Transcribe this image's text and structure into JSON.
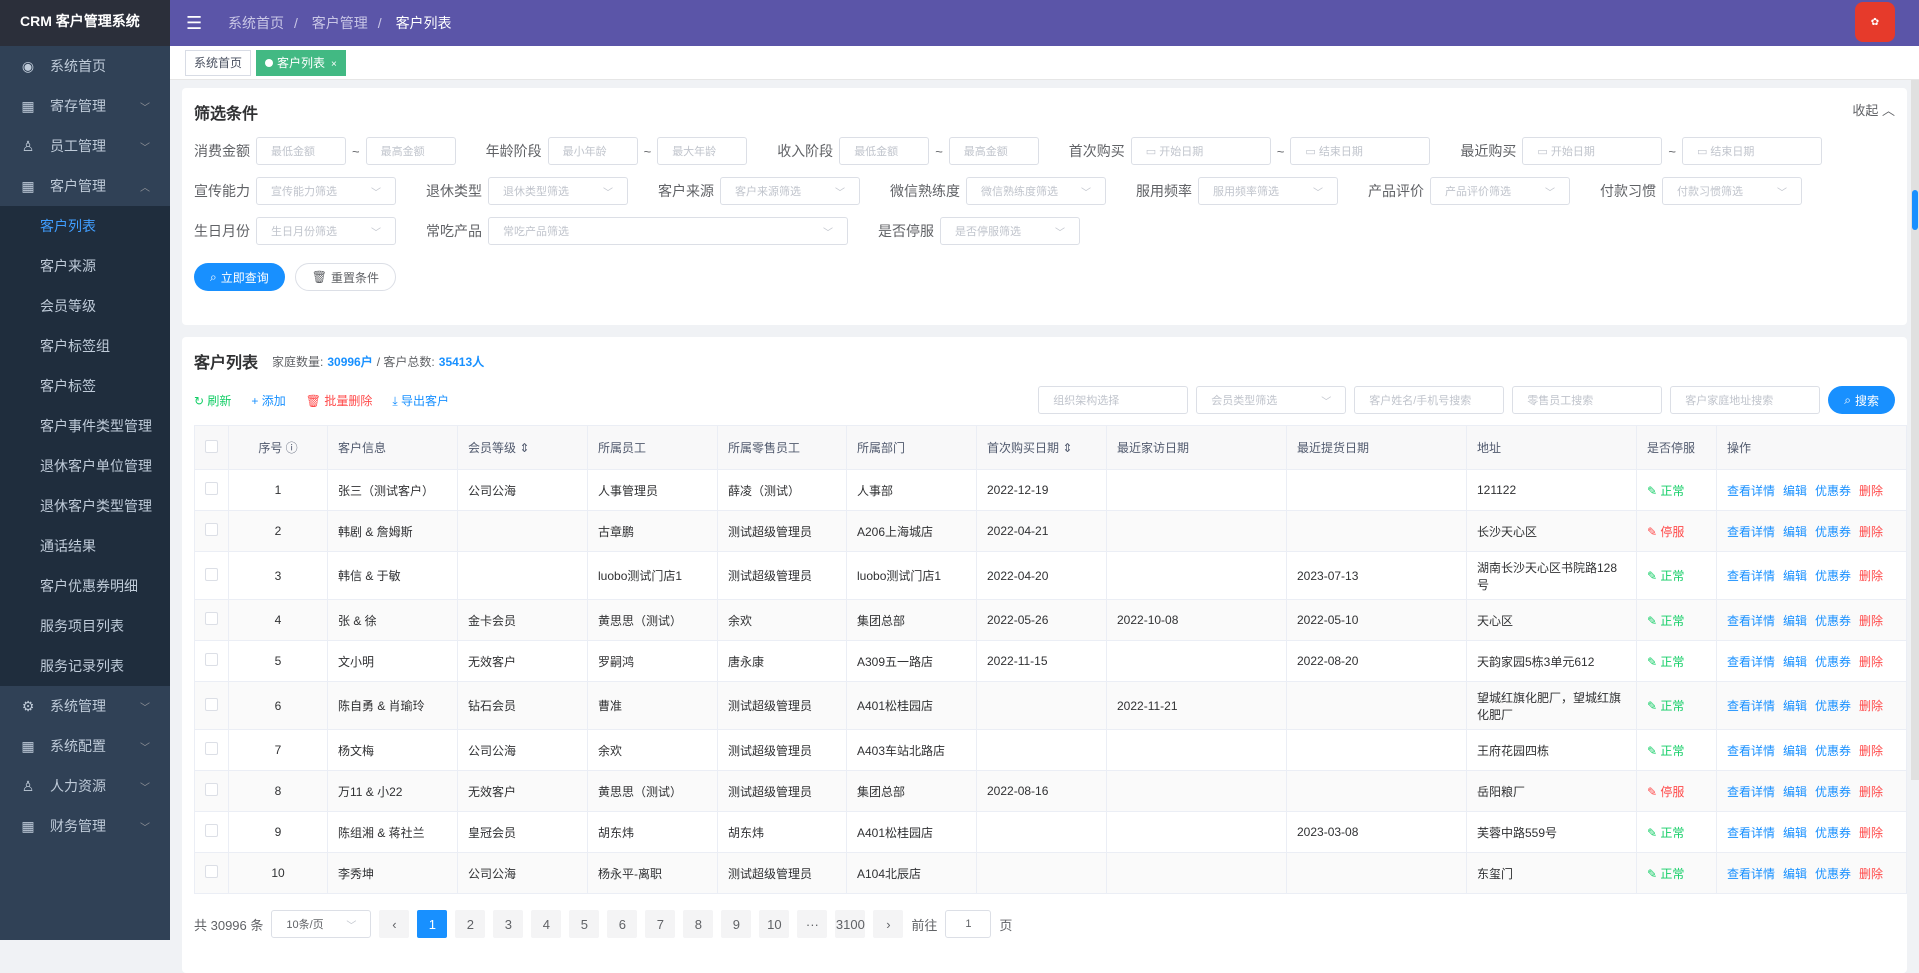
{
  "app": {
    "title": "CRM 客户管理系统"
  },
  "menu": [
    {
      "icon": "dashboard-icon",
      "glyph": "◉",
      "label": "系统首页",
      "arrow": ""
    },
    {
      "icon": "grid-icon",
      "glyph": "▦",
      "label": "寄存管理",
      "arrow": "﹀"
    },
    {
      "icon": "user-icon",
      "glyph": "♙",
      "label": "员工管理",
      "arrow": "﹀"
    },
    {
      "icon": "grid-icon",
      "glyph": "▦",
      "label": "客户管理",
      "arrow": "︿"
    }
  ],
  "submenu": [
    "客户列表",
    "客户来源",
    "会员等级",
    "客户标签组",
    "客户标签",
    "客户事件类型管理",
    "退休客户单位管理",
    "退休客户类型管理",
    "通话结果",
    "客户优惠券明细",
    "服务项目列表",
    "服务记录列表"
  ],
  "menu2": [
    {
      "icon": "gear-icon",
      "glyph": "⚙",
      "label": "系统管理",
      "arrow": "﹀"
    },
    {
      "icon": "grid-icon",
      "glyph": "▦",
      "label": "系统配置",
      "arrow": "﹀"
    },
    {
      "icon": "user-icon",
      "glyph": "♙",
      "label": "人力资源",
      "arrow": "﹀"
    },
    {
      "icon": "grid-icon",
      "glyph": "▦",
      "label": "财务管理",
      "arrow": "﹀"
    }
  ],
  "breadcrumb": [
    "系统首页",
    "客户管理",
    "客户列表"
  ],
  "tags": {
    "home": "系统首页",
    "current": "客户列表"
  },
  "filter": {
    "title": "筛选条件",
    "collapse": "收起 ︿",
    "consume": {
      "label": "消费金额",
      "min": "最低金额",
      "max": "最高金额"
    },
    "age": {
      "label": "年龄阶段",
      "min": "最小年龄",
      "max": "最大年龄"
    },
    "income": {
      "label": "收入阶段",
      "min": "最低金额",
      "max": "最高金额"
    },
    "first": {
      "label": "首次购买",
      "start": "开始日期",
      "end": "结束日期"
    },
    "recent": {
      "label": "最近购买",
      "start": "开始日期",
      "end": "结束日期"
    },
    "ability": {
      "label": "宣传能力",
      "ph": "宣传能力筛选"
    },
    "retire": {
      "label": "退休类型",
      "ph": "退休类型筛选"
    },
    "source": {
      "label": "客户来源",
      "ph": "客户来源筛选"
    },
    "wechat": {
      "label": "微信熟练度",
      "ph": "微信熟练度筛选"
    },
    "freq": {
      "label": "服用频率",
      "ph": "服用频率筛选"
    },
    "rating": {
      "label": "产品评价",
      "ph": "产品评价筛选"
    },
    "pay": {
      "label": "付款习惯",
      "ph": "付款习惯筛选"
    },
    "birth": {
      "label": "生日月份",
      "ph": "生日月份筛选"
    },
    "product": {
      "label": "常吃产品",
      "ph": "常吃产品筛选"
    },
    "stop": {
      "label": "是否停服",
      "ph": "是否停服筛选"
    },
    "query_btn": "立即查询",
    "reset_btn": "重置条件"
  },
  "list": {
    "title": "客户列表",
    "family_label": "家庭数量:",
    "family_count": "30996户",
    "sep": "/",
    "total_label": "客户总数:",
    "total_count": "35413人",
    "refresh": "刷新",
    "add": "添加",
    "batch_delete": "批量删除",
    "export": "导出客户",
    "search": {
      "org": "组织架构选择",
      "member": "会员类型筛选",
      "name": "客户姓名/手机号搜索",
      "staff": "零售员工搜索",
      "addr": "客户家庭地址搜索",
      "btn": "搜索"
    }
  },
  "table": {
    "headers": [
      "序号",
      "客户信息",
      "会员等级",
      "所属员工",
      "所属零售员工",
      "所属部门",
      "首次购买日期",
      "最近家访日期",
      "最近提货日期",
      "地址",
      "是否停服",
      "操作"
    ],
    "ops": [
      "查看详情",
      "编辑",
      "优惠券",
      "删除"
    ],
    "rows": [
      [
        "1",
        "张三（测试客户）",
        "公司公海",
        "人事管理员",
        "薛凌（测试）",
        "人事部",
        "2022-12-19",
        "",
        "",
        "121122",
        "正常"
      ],
      [
        "2",
        "韩剧 & 詹姆斯",
        "",
        "古章鹏",
        "测试超级管理员",
        "A206上海城店",
        "2022-04-21",
        "",
        "",
        "长沙天心区",
        "停服"
      ],
      [
        "3",
        "韩信 & 于敏",
        "",
        "luobo测试门店1",
        "测试超级管理员",
        "luobo测试门店1",
        "2022-04-20",
        "",
        "2023-07-13",
        "湖南长沙天心区书院路128号",
        "正常"
      ],
      [
        "4",
        "张 & 徐",
        "金卡会员",
        "黄思思（测试）",
        "余欢",
        "集团总部",
        "2022-05-26",
        "2022-10-08",
        "2022-05-10",
        "天心区",
        "正常"
      ],
      [
        "5",
        "文小明",
        "无效客户",
        "罗嗣鸿",
        "唐永康",
        "A309五一路店",
        "2022-11-15",
        "",
        "2022-08-20",
        "天韵家园5栋3单元612",
        "正常"
      ],
      [
        "6",
        "陈自勇 & 肖瑜玲",
        "钻石会员",
        "曹准",
        "测试超级管理员",
        "A401松桂园店",
        "",
        "2022-11-21",
        "",
        "望城红旗化肥厂，望城红旗化肥厂",
        "正常"
      ],
      [
        "7",
        "杨文梅",
        "公司公海",
        "余欢",
        "测试超级管理员",
        "A403车站北路店",
        "",
        "",
        "",
        "王府花园四栋",
        "正常"
      ],
      [
        "8",
        "万11 & 小22",
        "无效客户",
        "黄思思（测试）",
        "测试超级管理员",
        "集团总部",
        "2022-08-16",
        "",
        "",
        "岳阳粮厂",
        "停服"
      ],
      [
        "9",
        "陈组湘 & 蒋社兰",
        "皇冠会员",
        "胡东炜",
        "胡东炜",
        "A401松桂园店",
        "",
        "",
        "2023-03-08",
        "芙蓉中路559号",
        "正常"
      ],
      [
        "10",
        "李秀坤",
        "公司公海",
        "杨永平-离职",
        "测试超级管理员",
        "A104北辰店",
        "",
        "",
        "",
        "东玺门",
        "正常"
      ]
    ]
  },
  "pager": {
    "total": "共 30996 条",
    "size": "10条/页",
    "pages": [
      "1",
      "2",
      "3",
      "4",
      "5",
      "6",
      "7",
      "8",
      "9",
      "10",
      "···",
      "3100"
    ],
    "goto": "前往",
    "goto_val": "1",
    "unit": "页"
  }
}
